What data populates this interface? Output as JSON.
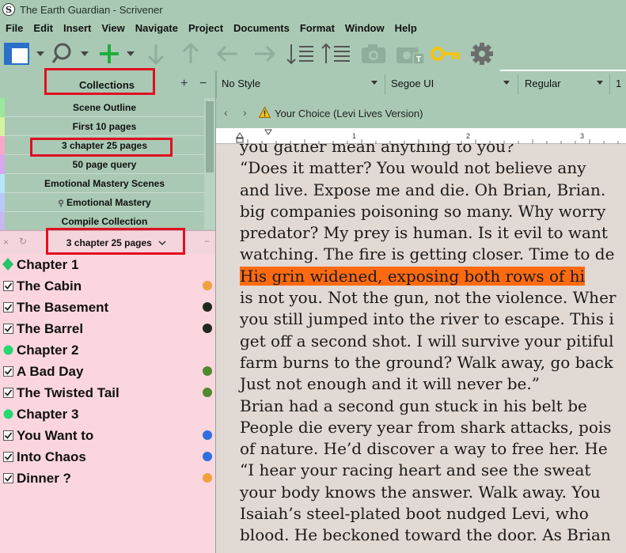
{
  "window": {
    "title": "The Earth Guardian - Scrivener",
    "app_icon": "S"
  },
  "menu": [
    "File",
    "Edit",
    "Insert",
    "View",
    "Navigate",
    "Project",
    "Documents",
    "Format",
    "Window",
    "Help"
  ],
  "toolbar_icons": [
    "layout-icon",
    "search-icon",
    "add-icon",
    "move-down-icon",
    "move-up-icon",
    "move-left-icon",
    "move-right-icon",
    "sort-down-icon",
    "sort-up-icon",
    "snapshot-icon",
    "snapshot-title-icon",
    "key-icon",
    "gear-icon"
  ],
  "colors": {
    "chrome": "#a9c9b4",
    "binder_bg": "#fcd6df",
    "editor_bg": "#e1d9d3",
    "highlight": "#ff6a10",
    "annotation": "#e01020"
  },
  "collections": {
    "header": "Collections",
    "add_label": "+",
    "remove_label": "−",
    "items": [
      {
        "label": "Scene Outline",
        "color": "#9be79b"
      },
      {
        "label": "First 10 pages",
        "color": "#d7f2a0"
      },
      {
        "label": "3 chapter 25 pages",
        "color": "#f7a8c9"
      },
      {
        "label": "50 page query",
        "color": "#d7a8f0"
      },
      {
        "label": "Emotional Mastery Scenes",
        "color": "#b6e6f7"
      },
      {
        "label": "Emotional Mastery",
        "color": "#b8c8f7",
        "search": true
      },
      {
        "label": "Compile Collection",
        "color": "#c8b8f0"
      }
    ]
  },
  "filter": {
    "label": "3 chapter 25 pages",
    "close": "×",
    "refresh": "↻",
    "dash": "−"
  },
  "binder": [
    {
      "label": "Chapter 1",
      "icon": "diamond",
      "icon_color": "#25c36a",
      "dot": ""
    },
    {
      "label": "The Cabin",
      "icon": "check",
      "dot": "#f0a040"
    },
    {
      "label": "The Basement",
      "icon": "check",
      "dot": "#1e2a1e"
    },
    {
      "label": "The Barrel",
      "icon": "check",
      "dot": "#1e2a1e"
    },
    {
      "label": "Chapter 2",
      "icon": "circle",
      "icon_color": "#25d870",
      "dot": ""
    },
    {
      "label": "A Bad Day",
      "icon": "check",
      "dot": "#4e8a2e"
    },
    {
      "label": "The Twisted Tail",
      "icon": "check",
      "dot": "#4e8a2e"
    },
    {
      "label": "Chapter 3",
      "icon": "circle",
      "icon_color": "#25d870",
      "dot": ""
    },
    {
      "label": "You Want to",
      "icon": "check",
      "dot": "#2f6fe0"
    },
    {
      "label": "Into Chaos",
      "icon": "check",
      "dot": "#2f6fe0"
    },
    {
      "label": "Dinner ?",
      "icon": "check",
      "dot": "#f0a040"
    }
  ],
  "format_bar": {
    "style": "No Style",
    "font": "Segoe UI",
    "weight": "Regular",
    "size": "1"
  },
  "document": {
    "title": "Your Choice (Levi Lives Version)",
    "back": "‹",
    "forward": "›"
  },
  "ruler_numbers": [
    "1",
    "2",
    "3"
  ],
  "editor_lines": [
    "you gather mean anything to you?",
    "     “Does it matter? You would not believe any",
    "and live. Expose me and die. Oh Brian, Brian.",
    "big companies poisoning so many. Why worry",
    "predator? My prey is human. Is it evil to want",
    "watching. The fire is getting closer. Time to de",
    "     His grin widened, exposing both rows of hi",
    "is not you. Not the gun, not the violence. Wher",
    "you still jumped into the river to escape. This i",
    "get off a second shot. I will survive your pitiful",
    "farm burns to the ground? Walk away, go back",
    "Just not enough and it will never be.”",
    "     Brian had a second gun stuck in his belt be",
    "People die every year from shark attacks, pois",
    "of nature. He’d discover a way to free her. He",
    "     “I hear your racing heart and see the sweat",
    "your body knows the answer. Walk away. You",
    "     Isaiah’s steel-plated boot nudged Levi, who",
    "blood. He beckoned toward the door. As Brian"
  ]
}
